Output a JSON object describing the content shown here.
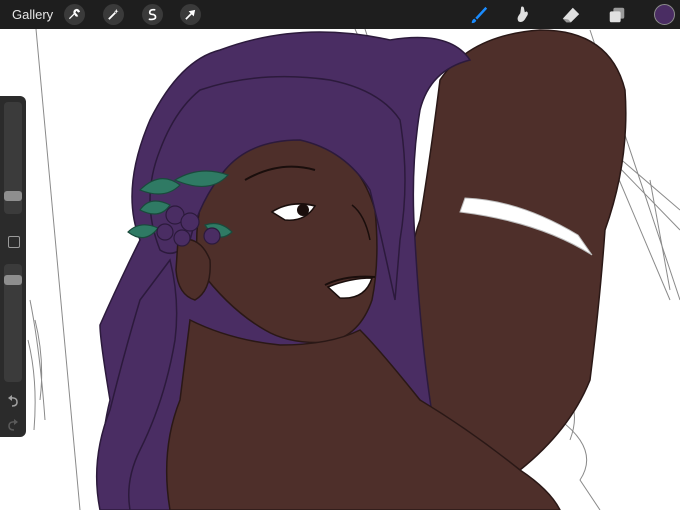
{
  "toolbar": {
    "gallery_label": "Gallery",
    "left_tools": [
      "wrench-icon",
      "magic-wand-icon",
      "selection-icon",
      "transform-arrow-icon"
    ],
    "right_tools": [
      "brush-icon",
      "smudge-icon",
      "eraser-icon",
      "layers-icon",
      "color-swatch"
    ],
    "active_tool": "brush-icon",
    "active_color": "#4a2d63",
    "accent_color": "#1a8cff"
  },
  "sidebar": {
    "brush_size": 0.13,
    "brush_opacity": 0.9,
    "controls": [
      "brush-size-slider",
      "modify-button",
      "opacity-slider",
      "undo-icon",
      "redo-icon"
    ]
  },
  "palette": {
    "hair": "#4a2d63",
    "skin": "#4e2f2a",
    "leaves": "#2f7a64",
    "band": "#ffffff"
  }
}
